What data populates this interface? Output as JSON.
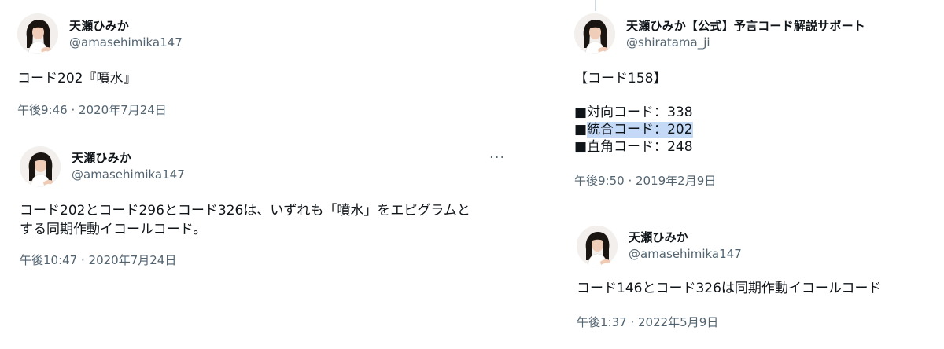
{
  "tweets": [
    {
      "name": "天瀬ひみか",
      "handle": "@amasehimika147",
      "text": "コード202『噴水』",
      "time": "午後9:46 · 2020年7月24日"
    },
    {
      "name": "天瀬ひみか",
      "handle": "@amasehimika147",
      "more_label": "···",
      "text_line1": "コード202とコード296とコード326は、いずれも「噴水」をエピグラムと",
      "text_line2": "する同期作動イコールコード。",
      "time": "午後10:47 · 2020年7月24日"
    },
    {
      "name": "天瀬ひみか【公式】予言コード解説サポート",
      "handle": "@shiratama_ji",
      "heading": "【コード158】",
      "lines": [
        {
          "bullet": "■",
          "label": "対向コード：",
          "value": "338"
        },
        {
          "bullet": "■",
          "label": "統合コード：",
          "value": "202"
        },
        {
          "bullet": "■",
          "label": "直角コード：",
          "value": "248"
        }
      ],
      "time": "午後9:50 · 2019年2月9日"
    },
    {
      "name": "天瀬ひみか",
      "handle": "@amasehimika147",
      "text": "コード146とコード326は同期作動イコールコード",
      "time": "午後1:37 · 2022年5月9日"
    }
  ],
  "colors": {
    "text": "#0f1419",
    "secondary": "#536471",
    "highlight": "#c4d9f5"
  },
  "icons": {
    "avatar": "profile-photo-avatar",
    "more": "more-options-icon"
  }
}
